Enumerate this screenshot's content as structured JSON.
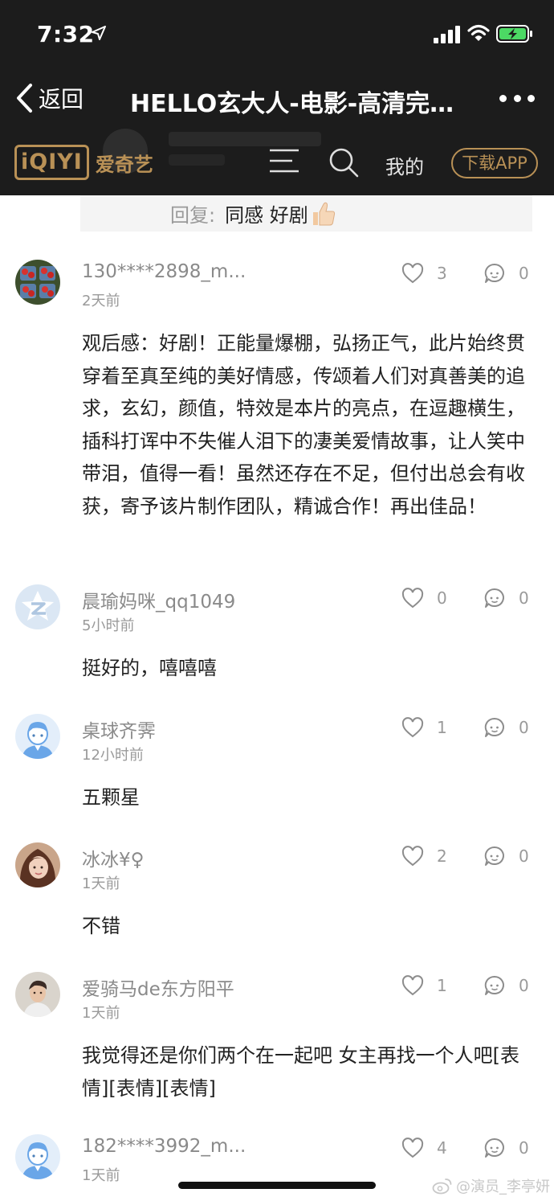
{
  "status_bar": {
    "time": "7:32"
  },
  "navbar": {
    "back_label": "返回",
    "title": "HELLO玄大人-电影-高清完整正版视频在线观看-爱奇艺"
  },
  "site_bar": {
    "logo_mark": "iQIYI",
    "logo_text": "爱奇艺",
    "mine_label": "我的",
    "download_label": "下载APP"
  },
  "reply_strip": {
    "prefix": "回复:",
    "text": "同感 好剧"
  },
  "comments": [
    {
      "name": "130****2898_m...",
      "time": "2天前",
      "likes": "3",
      "replies": "0",
      "text": "观后感：好剧！正能量爆棚，弘扬正气，此片始终贯穿着至真至纯的美好情感，传颂着人们对真善美的追求，玄幻，颜值，特效是本片的亮点，在逗趣横生，插科打诨中不失催人泪下的凄美爱情故事，让人笑中带泪，值得一看！虽然还存在不足，但付出总会有收获，寄予该片制作团队，精诚合作！再出佳品！"
    },
    {
      "name": "晨瑜妈咪_qq1049",
      "time": "5小时前",
      "likes": "0",
      "replies": "0",
      "text": "挺好的，嘻嘻嘻"
    },
    {
      "name": "桌球齐霁",
      "time": "12小时前",
      "likes": "1",
      "replies": "0",
      "text": "五颗星"
    },
    {
      "name": "冰冰¥♀",
      "time": "1天前",
      "likes": "2",
      "replies": "0",
      "text": "不错"
    },
    {
      "name": "爱骑马de东方阳平",
      "time": "1天前",
      "likes": "1",
      "replies": "0",
      "text": "我觉得还是你们两个在一起吧 女主再找一个人吧[表情][表情][表情]"
    },
    {
      "name": "182****3992_m...",
      "time": "1天前",
      "likes": "4",
      "replies": "0",
      "text": ""
    }
  ],
  "watermark": "@演员_李亭妍",
  "colors": {
    "header_bg": "#1c1c1c",
    "brand_gold": "#b99156",
    "muted": "#9a9a9a"
  }
}
